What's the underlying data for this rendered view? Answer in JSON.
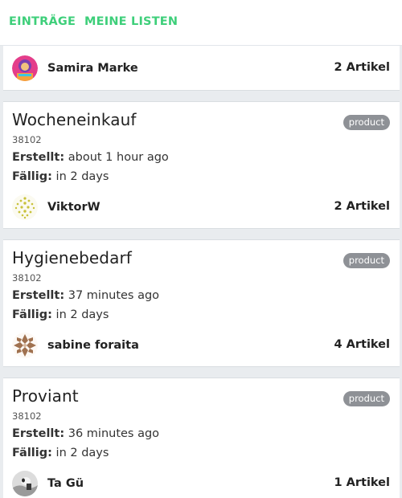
{
  "tabs": [
    {
      "label": "EINTRÄGE"
    },
    {
      "label": "MEINE LISTEN"
    }
  ],
  "labels": {
    "created": "Erstellt:",
    "due": "Fällig:"
  },
  "lists": [
    {
      "title": "",
      "id": "",
      "owner": "Samira Marke",
      "item_count": "2 Artikel",
      "avatar": "colorful-avatar"
    },
    {
      "title": "Wocheneinkauf",
      "badge": "product",
      "id": "38102",
      "created": "about 1 hour ago",
      "due": "in 2 days",
      "owner": "ViktorW",
      "item_count": "2 Artikel",
      "avatar": "pattern-avatar-yellow"
    },
    {
      "title": "Hygienebedarf",
      "badge": "product",
      "id": "38102",
      "created": "37 minutes ago",
      "due": "in 2 days",
      "owner": "sabine foraita",
      "item_count": "4 Artikel",
      "avatar": "pattern-avatar-brown"
    },
    {
      "title": "Proviant",
      "badge": "product",
      "id": "38102",
      "created": "36 minutes ago",
      "due": "in 2 days",
      "owner": "Ta Gü",
      "item_count": "1 Artikel",
      "avatar": "photo-avatar"
    }
  ],
  "colors": {
    "accent": "#3ecf7a",
    "badge_bg": "#8e9196",
    "page_bg": "#e9ecef"
  }
}
